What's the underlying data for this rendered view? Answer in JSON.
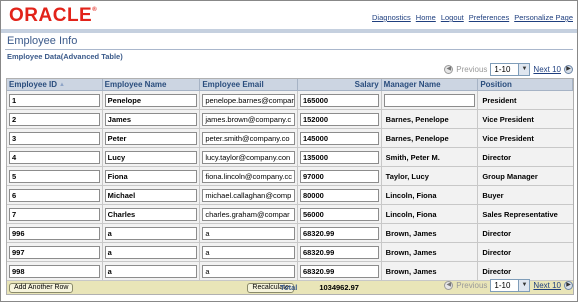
{
  "header": {
    "logo_text": "ORACLE",
    "logo_mark": "®",
    "links": [
      "Diagnostics",
      "Home",
      "Logout",
      "Preferences",
      "Personalize Page"
    ]
  },
  "page": {
    "title": "Employee Info",
    "subtitle": "Employee Data(Advanced Table)"
  },
  "nav": {
    "previous": "Previous",
    "range": "1-10",
    "next": "Next 10"
  },
  "table": {
    "columns": [
      "Employee ID",
      "Employee Name",
      "Employee Email",
      "Salary",
      "Manager Name",
      "Position"
    ],
    "rows": [
      {
        "id": "1",
        "name": "Penelope",
        "email": "penelope.barnes@compar",
        "salary": "165000",
        "manager": "",
        "position": "President"
      },
      {
        "id": "2",
        "name": "James",
        "email": "james.brown@company.c",
        "salary": "152000",
        "manager": "Barnes, Penelope",
        "position": "Vice President"
      },
      {
        "id": "3",
        "name": "Peter",
        "email": "peter.smith@company.co",
        "salary": "145000",
        "manager": "Barnes, Penelope",
        "position": "Vice President"
      },
      {
        "id": "4",
        "name": "Lucy",
        "email": "lucy.taylor@company.con",
        "salary": "135000",
        "manager": "Smith, Peter M.",
        "position": "Director"
      },
      {
        "id": "5",
        "name": "Fiona",
        "email": "fiona.lincoln@company.cc",
        "salary": "97000",
        "manager": "Taylor, Lucy",
        "position": "Group Manager"
      },
      {
        "id": "6",
        "name": "Michael",
        "email": "michael.callaghan@comp",
        "salary": "80000",
        "manager": "Lincoln, Fiona",
        "position": "Buyer"
      },
      {
        "id": "7",
        "name": "Charles",
        "email": "charles.graham@compar",
        "salary": "56000",
        "manager": "Lincoln, Fiona",
        "position": "Sales Representative"
      },
      {
        "id": "996",
        "name": "a",
        "email": "a",
        "salary": "68320.99",
        "manager": "Brown, James",
        "position": "Director"
      },
      {
        "id": "997",
        "name": "a",
        "email": "a",
        "salary": "68320.99",
        "manager": "Brown, James",
        "position": "Director"
      },
      {
        "id": "998",
        "name": "a",
        "email": "a",
        "salary": "68320.99",
        "manager": "Brown, James",
        "position": "Director"
      }
    ],
    "add_row_label": "Add Another Row",
    "recalculate_label": "Recalculate",
    "total_label": "Total",
    "total_value": "1034962.97"
  }
}
